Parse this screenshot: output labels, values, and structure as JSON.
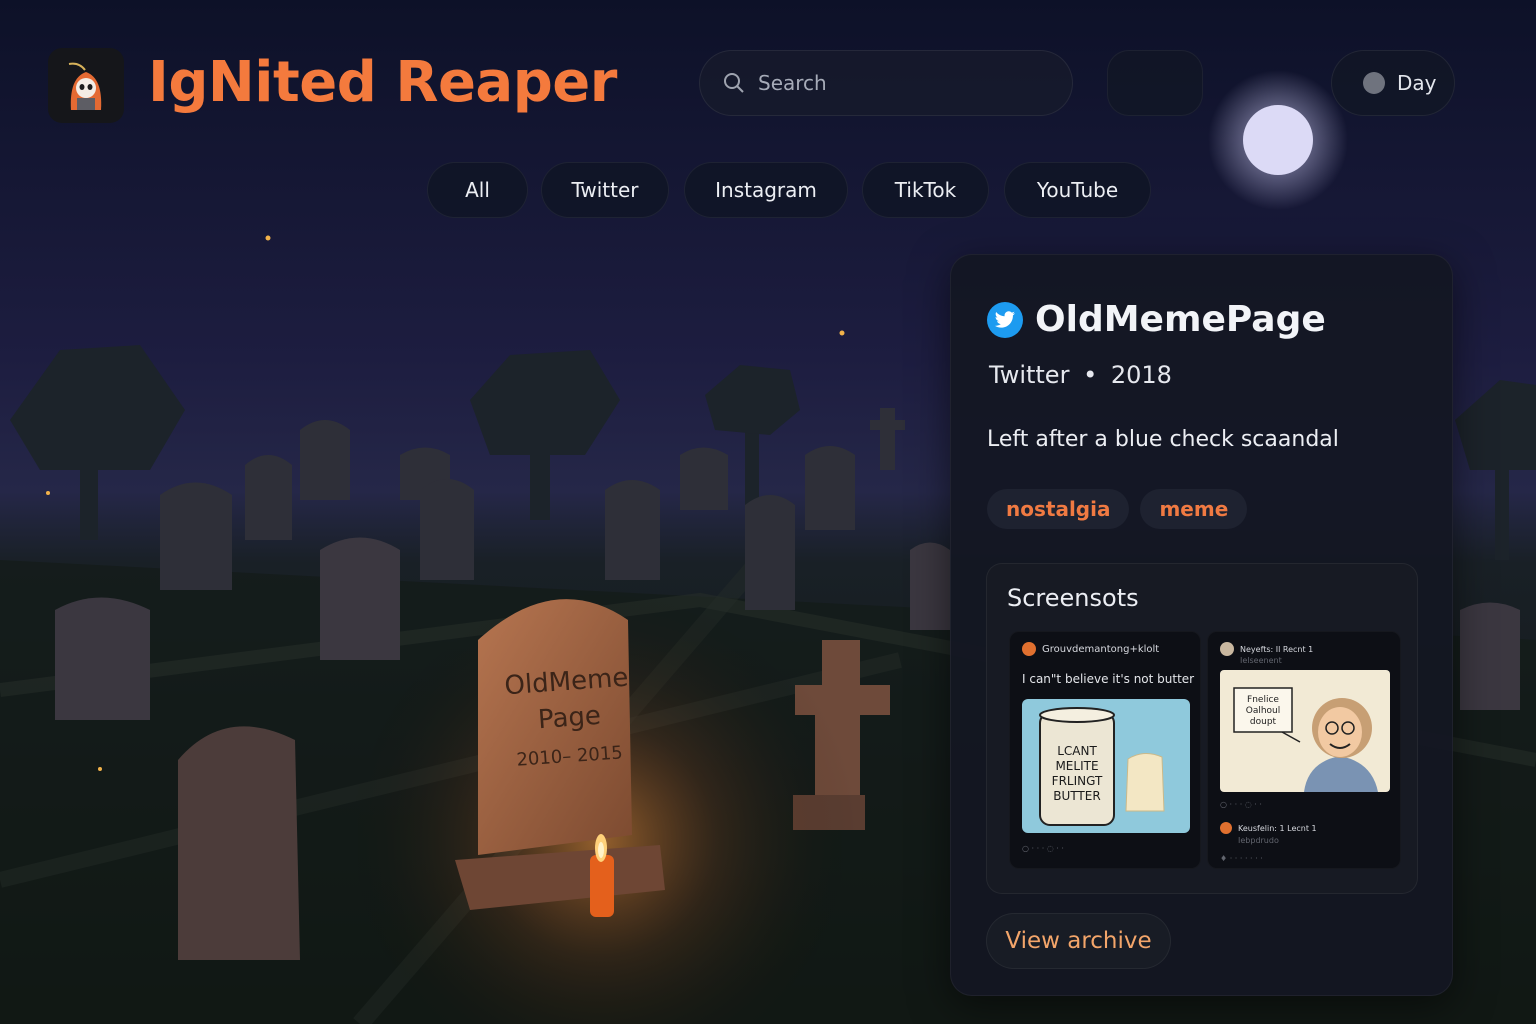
{
  "app": {
    "brand": "IgNited Reaper"
  },
  "search": {
    "placeholder": "Search"
  },
  "theme_toggle": {
    "label": "Day"
  },
  "filters": [
    {
      "label": "All"
    },
    {
      "label": "Twitter"
    },
    {
      "label": "Instagram"
    },
    {
      "label": "TikTok"
    },
    {
      "label": "YouTube"
    }
  ],
  "tombstone": {
    "name_line1": "OldMeme",
    "name_line2": "Page",
    "dates": "2010– 2015"
  },
  "card": {
    "name": "OldMemePage",
    "platform": "Twitter",
    "separator": "•",
    "year": "2018",
    "description": "Left after a blue check scaandal",
    "tags": [
      "nostalgia",
      "meme"
    ],
    "screenshots": {
      "title": "Screensots",
      "items": [
        {
          "handle": "Grouvdemantong+klolt",
          "text": "I can\"t believe it's not butter",
          "image_text": [
            "LCANT",
            "MELITE",
            "FRLINGT",
            "BUTTER"
          ]
        },
        {
          "handle": "Neyefts: Il Recnt 1",
          "subhandle": "Ielseenent",
          "bubble_text": [
            "Fnelice",
            "Oalhoul",
            "doupt"
          ],
          "reply_handle": "Keusfelin: 1 Lecnt 1",
          "reply_sub": "Iebpdrudo"
        }
      ]
    },
    "view_label": "View archive"
  },
  "colors": {
    "accent": "#f47a3d",
    "twitter_blue": "#1d9bf0",
    "background_sky": "#0e1228"
  }
}
